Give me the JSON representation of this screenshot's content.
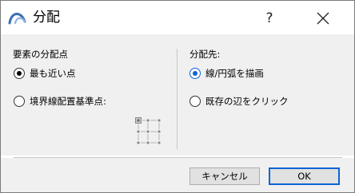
{
  "window": {
    "title": "分配",
    "help_label": "?",
    "icon": "archicad-arc-icon"
  },
  "left_group": {
    "label": "要素の分配点",
    "options": [
      {
        "label": "最も近い点",
        "checked": true
      },
      {
        "label": "境界線配置基準点:",
        "checked": false
      }
    ],
    "anchor_icon": "anchor-point-grid-icon"
  },
  "right_group": {
    "label": "分配先:",
    "options": [
      {
        "label": "線/円弧を描画",
        "checked": true
      },
      {
        "label": "既存の辺をクリック",
        "checked": false
      }
    ]
  },
  "footer": {
    "cancel_label": "キャンセル",
    "ok_label": "OK"
  },
  "colors": {
    "accent": "#0a64d6",
    "panel_bg": "#f0f0f0",
    "button_bg": "#e1e1e1"
  }
}
